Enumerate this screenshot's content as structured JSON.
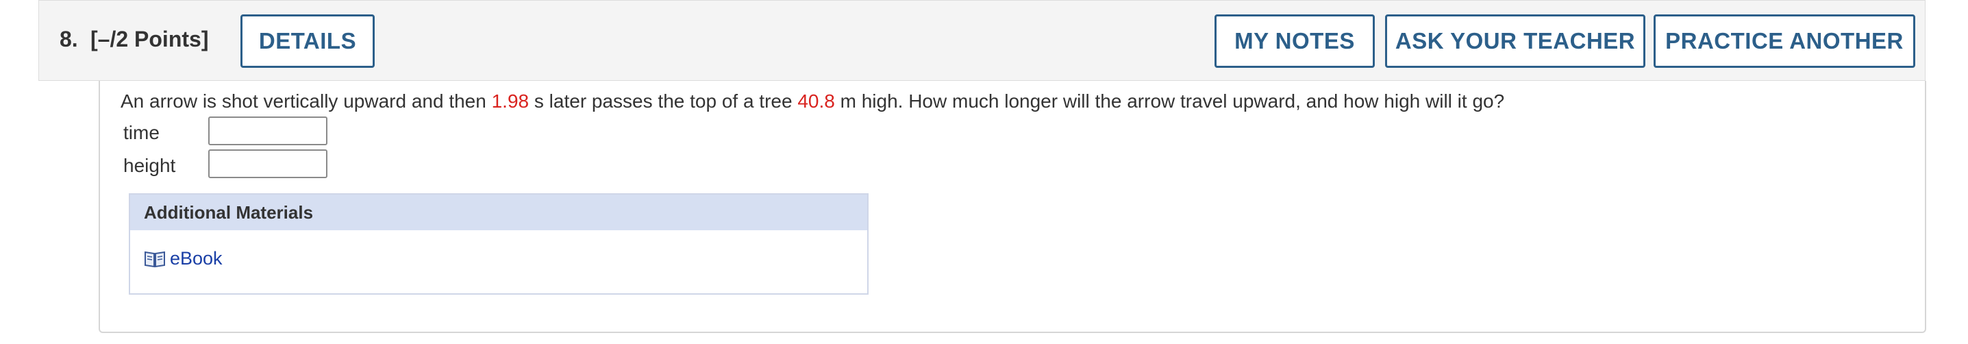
{
  "header": {
    "question_number": "8.",
    "points": "[–/2 Points]",
    "details_label": "DETAILS",
    "notes_label": "MY NOTES",
    "teacher_label": "ASK YOUR TEACHER",
    "practice_label": "PRACTICE ANOTHER"
  },
  "question": {
    "text_part1": "An arrow is shot vertically upward and then ",
    "value1": "1.98",
    "text_part2": " s later passes the top of a tree ",
    "value2": "40.8",
    "text_part3": " m high. How much longer will the arrow travel upward, and how high will it go?",
    "highlight_color": "#d9231f"
  },
  "fields": [
    {
      "label": "time",
      "value": ""
    },
    {
      "label": "height",
      "value": ""
    }
  ],
  "materials": {
    "heading": "Additional Materials",
    "link_label": "eBook",
    "link_icon": "book-icon"
  },
  "colors": {
    "button_accent": "#2c5f8a",
    "link": "#1a3fa6",
    "materials_header_bg": "#d6dff2"
  }
}
